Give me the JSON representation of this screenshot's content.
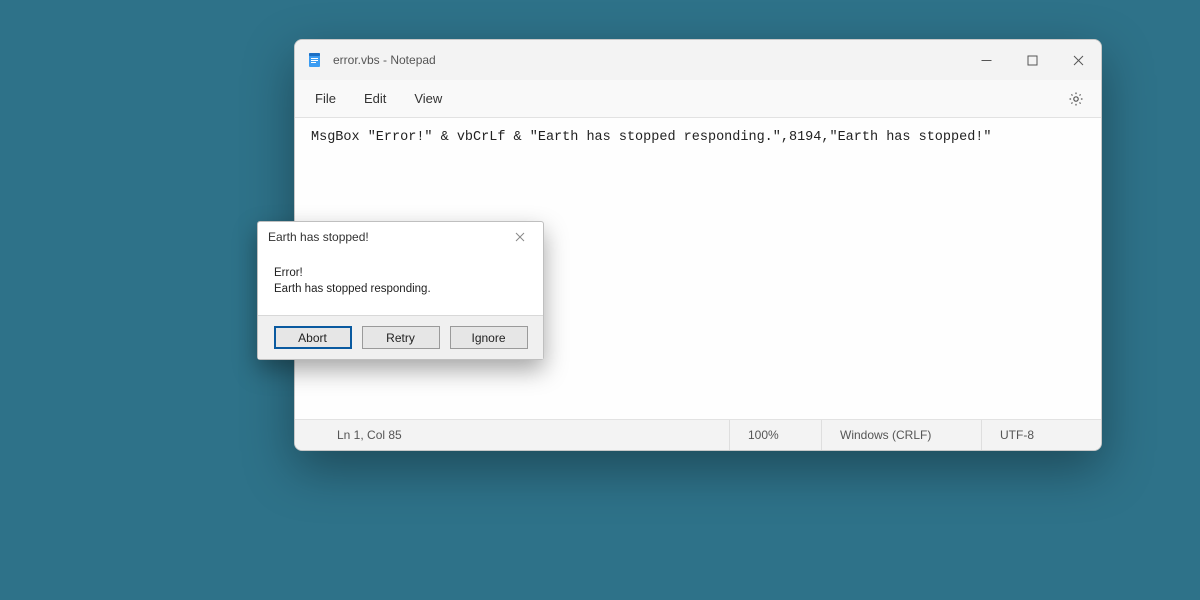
{
  "notepad": {
    "title": "error.vbs - Notepad",
    "menu": {
      "file": "File",
      "edit": "Edit",
      "view": "View"
    },
    "content": "MsgBox \"Error!\" & vbCrLf & \"Earth has stopped responding.\",8194,\"Earth has stopped!\"",
    "status": {
      "cursor": "Ln 1, Col 85",
      "zoom": "100%",
      "line_ending": "Windows (CRLF)",
      "encoding": "UTF-8"
    }
  },
  "dialog": {
    "title": "Earth has stopped!",
    "line1": "Error!",
    "line2": "Earth has stopped responding.",
    "buttons": {
      "abort": "Abort",
      "retry": "Retry",
      "ignore": "Ignore"
    }
  }
}
